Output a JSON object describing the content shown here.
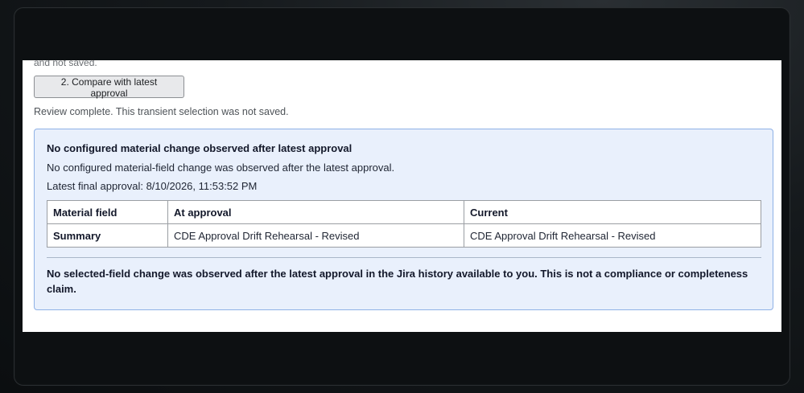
{
  "page": {
    "clipped_text": "and not saved."
  },
  "actions": {
    "compare_button_label": "2. Compare with latest approval"
  },
  "status_text": "Review complete. This transient selection was not saved.",
  "result": {
    "title": "No configured material change observed after latest approval",
    "description": "No configured material-field change was observed after the latest approval.",
    "latest_approval_text": "Latest final approval: 8/10/2026, 11:53:52 PM",
    "table": {
      "headers": [
        "Material field",
        "At approval",
        "Current"
      ],
      "rows": [
        {
          "field": "Summary",
          "at_approval": "CDE Approval Drift Rehearsal - Revised",
          "current": "CDE Approval Drift Rehearsal - Revised"
        }
      ]
    },
    "note": "No selected-field change was observed after the latest approval in the Jira history available to you. This is not a compliance or completeness claim."
  },
  "colors": {
    "result_background": "#e9f0fc",
    "result_border": "#8eb1e6",
    "panel_background": "#ffffff",
    "frame_background": "#0d1012"
  }
}
